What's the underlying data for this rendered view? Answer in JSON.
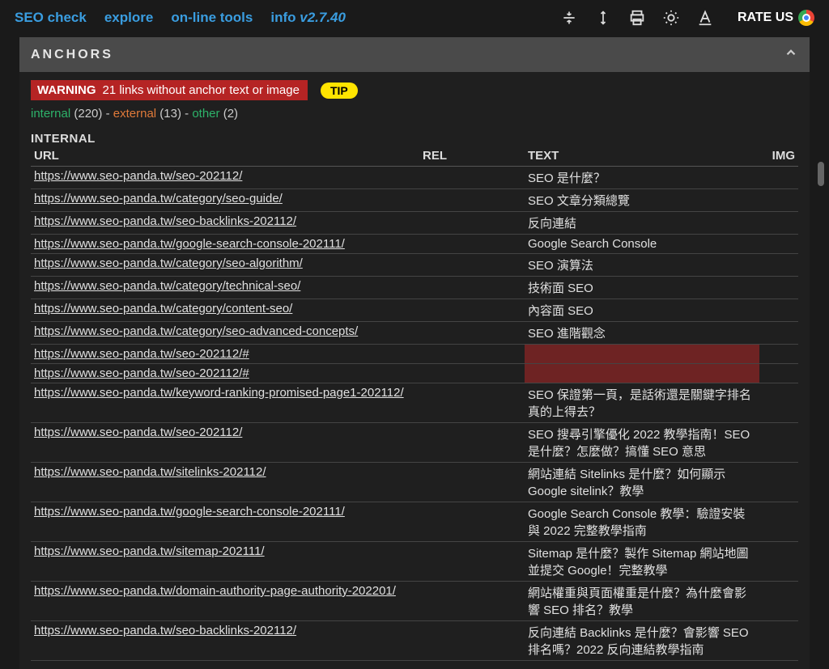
{
  "nav": {
    "seo_check": "SEO check",
    "explore": "explore",
    "tools": "on-line tools",
    "info": "info",
    "version": "v2.7.40",
    "rate": "RATE US"
  },
  "panel": {
    "title": "ANCHORS"
  },
  "warning": {
    "label": "WARNING",
    "text": "21 links without anchor text or image",
    "tip": "TIP"
  },
  "counts": {
    "internal_label": "internal",
    "internal_n": "(220)",
    "external_label": "external",
    "external_n": "(13)",
    "other_label": "other",
    "other_n": "(2)",
    "dash": " - "
  },
  "section": {
    "internal": "INTERNAL"
  },
  "headers": {
    "url": "URL",
    "rel": "REL",
    "text": "TEXT",
    "img": "IMG"
  },
  "rows": [
    {
      "url": "https://www.seo-panda.tw/seo-202112/",
      "rel": "",
      "text": "SEO 是什麼？",
      "missing": false
    },
    {
      "url": "https://www.seo-panda.tw/category/seo-guide/",
      "rel": "",
      "text": "SEO 文章分類總覽",
      "missing": false
    },
    {
      "url": "https://www.seo-panda.tw/seo-backlinks-202112/",
      "rel": "",
      "text": "反向連結",
      "missing": false
    },
    {
      "url": "https://www.seo-panda.tw/google-search-console-202111/",
      "rel": "",
      "text": "Google Search Console",
      "missing": false
    },
    {
      "url": "https://www.seo-panda.tw/category/seo-algorithm/",
      "rel": "",
      "text": "SEO 演算法",
      "missing": false
    },
    {
      "url": "https://www.seo-panda.tw/category/technical-seo/",
      "rel": "",
      "text": "技術面 SEO",
      "missing": false
    },
    {
      "url": "https://www.seo-panda.tw/category/content-seo/",
      "rel": "",
      "text": "內容面 SEO",
      "missing": false
    },
    {
      "url": "https://www.seo-panda.tw/category/seo-advanced-concepts/",
      "rel": "",
      "text": "SEO 進階觀念",
      "missing": false
    },
    {
      "url": "https://www.seo-panda.tw/seo-202112/#",
      "rel": "",
      "text": "",
      "missing": true
    },
    {
      "url": "https://www.seo-panda.tw/seo-202112/#",
      "rel": "",
      "text": "",
      "missing": true
    },
    {
      "url": "https://www.seo-panda.tw/keyword-ranking-promised-page1-202112/",
      "rel": "",
      "text": "SEO 保證第一頁，是話術還是關鍵字排名真的上得去？",
      "missing": false
    },
    {
      "url": "https://www.seo-panda.tw/seo-202112/",
      "rel": "",
      "text": "SEO 搜尋引擎優化 2022 教學指南！SEO 是什麼？怎麼做？搞懂 SEO 意思",
      "missing": false
    },
    {
      "url": "https://www.seo-panda.tw/sitelinks-202112/",
      "rel": "",
      "text": "網站連結 Sitelinks 是什麼？如何顯示 Google sitelink？教學",
      "missing": false
    },
    {
      "url": "https://www.seo-panda.tw/google-search-console-202111/",
      "rel": "",
      "text": "Google Search Console 教學：驗證安裝與 2022 完整教學指南",
      "missing": false
    },
    {
      "url": "https://www.seo-panda.tw/sitemap-202111/",
      "rel": "",
      "text": "Sitemap 是什麼？製作 Sitemap 網站地圖並提交 Google！完整教學",
      "missing": false
    },
    {
      "url": "https://www.seo-panda.tw/domain-authority-page-authority-202201/",
      "rel": "",
      "text": "網站權重與頁面權重是什麼？為什麼會影響 SEO 排名？教學",
      "missing": false
    },
    {
      "url": "https://www.seo-panda.tw/seo-backlinks-202112/",
      "rel": "",
      "text": "反向連結 Backlinks 是什麼？會影響 SEO 排名嗎？2022 反向連結教學指南",
      "missing": false
    }
  ]
}
